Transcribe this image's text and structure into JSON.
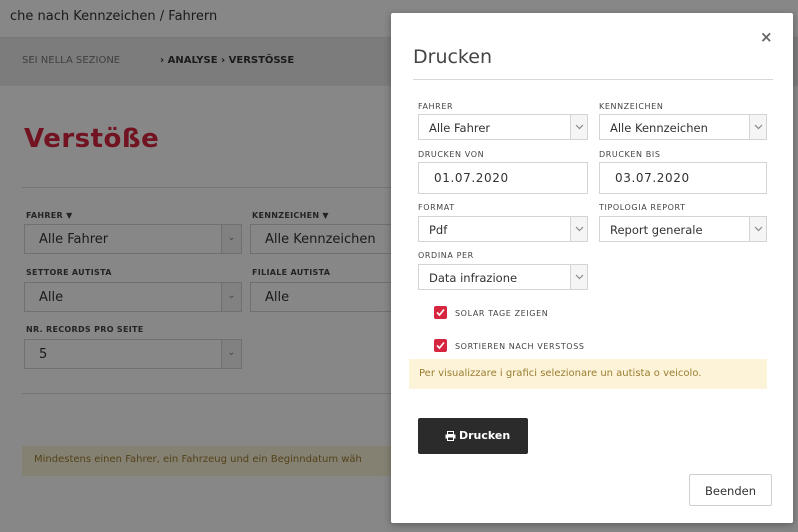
{
  "background": {
    "topbar_text": "che nach Kennzeichen / Fahrern",
    "breadcrumb": {
      "prefix": "SEI NELLA SEZIONE",
      "path": "› ANALYSE › VERSTÖSSE"
    },
    "page_title": "Verstöße",
    "filters": {
      "fahrer_label": "FAHRER ▼",
      "fahrer_value": "Alle Fahrer",
      "kennzeichen_label": "KENNZEICHEN ▼",
      "kennzeichen_value": "Alle Kennzeichen",
      "settore_label": "SETTORE AUTISTA",
      "settore_value": "Alle",
      "filiale_label": "FILIALE AUTISTA",
      "filiale_value": "Alle",
      "records_label": "NR. RECORDS PRO SEITE",
      "records_value": "5"
    },
    "warning": "Mindestens einen Fahrer, ein Fahrzeug und ein Beginndatum wäh"
  },
  "modal": {
    "title": "Drucken",
    "close_symbol": "×",
    "fahrer": {
      "label": "FAHRER",
      "value": "Alle Fahrer"
    },
    "kennzeichen": {
      "label": "KENNZEICHEN",
      "value": "Alle Kennzeichen"
    },
    "drucken_von": {
      "label": "DRUCKEN VON",
      "value": "01.07.2020"
    },
    "drucken_bis": {
      "label": "DRUCKEN BIS",
      "value": "03.07.2020"
    },
    "format": {
      "label": "FORMAT",
      "value": "Pdf"
    },
    "tipologia": {
      "label": "TIPOLOGIA REPORT",
      "value": "Report generale"
    },
    "ordina": {
      "label": "ORDINA PER",
      "value": "Data infrazione"
    },
    "checkbox_solar": {
      "label": "SOLAR TAGE ZEIGEN",
      "checked": true
    },
    "checkbox_sortieren": {
      "label": "SORTIEREN NACH VERSTOSS",
      "checked": true
    },
    "info_text": "Per visualizzare i grafici selezionare un autista o veicolo.",
    "print_button": "Drucken",
    "close_button": "Beenden"
  },
  "colors": {
    "accent": "#d6253e",
    "dark_button": "#2b2b2b",
    "warning_bg": "#fcf3d8",
    "warning_text": "#9b7d32"
  }
}
